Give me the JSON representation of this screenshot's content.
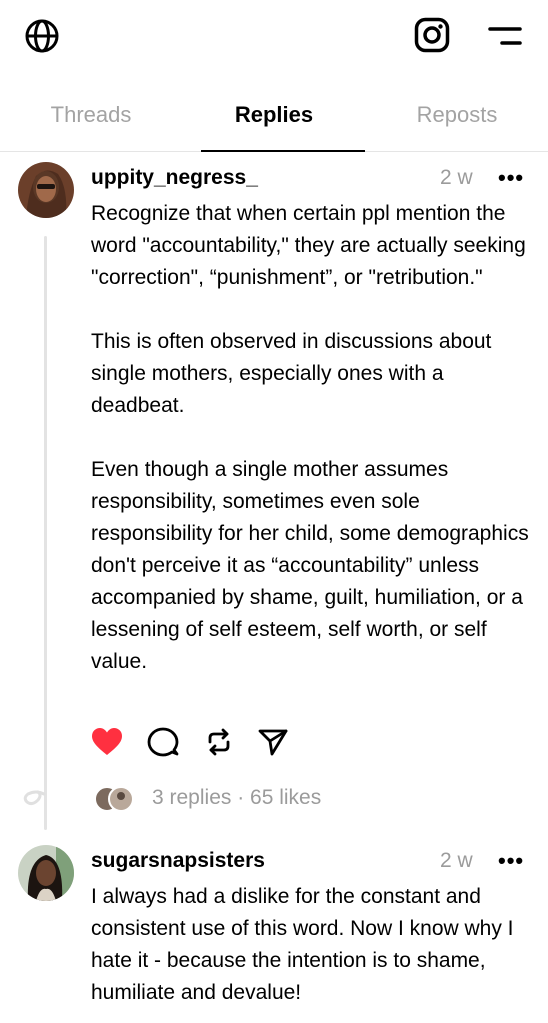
{
  "tabs": [
    {
      "label": "Threads",
      "active": false
    },
    {
      "label": "Replies",
      "active": true
    },
    {
      "label": "Reposts",
      "active": false
    }
  ],
  "posts": [
    {
      "username": "uppity_negress_",
      "time": "2 w",
      "more": "•••",
      "text": "Recognize that when certain ppl mention the word \"accountability,\" they are actually seeking \"correction\", “punishment”, or \"retribution.\"\n\nThis is often observed in discussions about single mothers, especially ones with a deadbeat.\n\nEven though a single mother assumes responsibility, sometimes even sole responsibility for her child, some demographics don't perceive it as “accountability” unless accompanied by shame, guilt, humiliation, or a lessening of self esteem, self worth, or self value.",
      "liked": true,
      "stats": "3 replies · 65 likes"
    },
    {
      "username": "sugarsnapsisters",
      "time": "2 w",
      "more": "•••",
      "text": "I always had a dislike for the constant and consistent use of this word. Now I know why I hate it - because the intention is to shame, humiliate and devalue!"
    }
  ],
  "colors": {
    "like_red": "#ff3040",
    "muted_text": "#9b9b9b",
    "divider": "#e5e5e5"
  },
  "icons": [
    "globe-icon",
    "instagram-icon",
    "menu-icon",
    "heart-icon",
    "comment-icon",
    "repost-icon",
    "share-icon"
  ]
}
